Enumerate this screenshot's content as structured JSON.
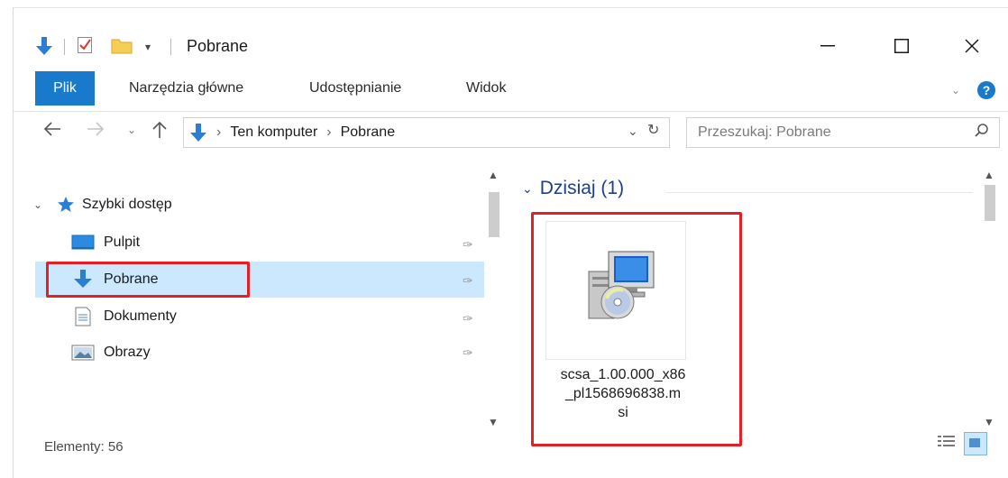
{
  "window": {
    "title": "Pobrane",
    "controls": {
      "minimize": "—",
      "maximize": "☐",
      "close": "✕"
    }
  },
  "ribbon": {
    "tabs": [
      "Plik",
      "Narzędzia główne",
      "Udostępnianie",
      "Widok"
    ],
    "help_icon": "?"
  },
  "address": {
    "crumbs": [
      "Ten komputer",
      "Pobrane"
    ],
    "search_placeholder": "Przeszukaj: Pobrane"
  },
  "sidebar": {
    "quick_access": "Szybki dostęp",
    "items": [
      {
        "label": "Pulpit",
        "icon": "desktop-icon"
      },
      {
        "label": "Pobrane",
        "icon": "download-arrow-icon",
        "selected": true
      },
      {
        "label": "Dokumenty",
        "icon": "document-icon"
      },
      {
        "label": "Obrazy",
        "icon": "picture-icon"
      }
    ]
  },
  "status": {
    "items_count": "Elementy: 56"
  },
  "content": {
    "group_label": "Dzisiaj (1)",
    "files": [
      {
        "name": "scsa_1.00.000_x86_pl1568696838.msi",
        "name_lines": [
          "scsa_1.00.000_x86",
          "_pl1568696838.m",
          "si"
        ],
        "icon": "msi-installer-icon"
      }
    ]
  },
  "colors": {
    "accent": "#1979ca",
    "selection": "#cce8ff",
    "highlight_box": "#e41f26",
    "group_header": "#1e3e8c"
  }
}
